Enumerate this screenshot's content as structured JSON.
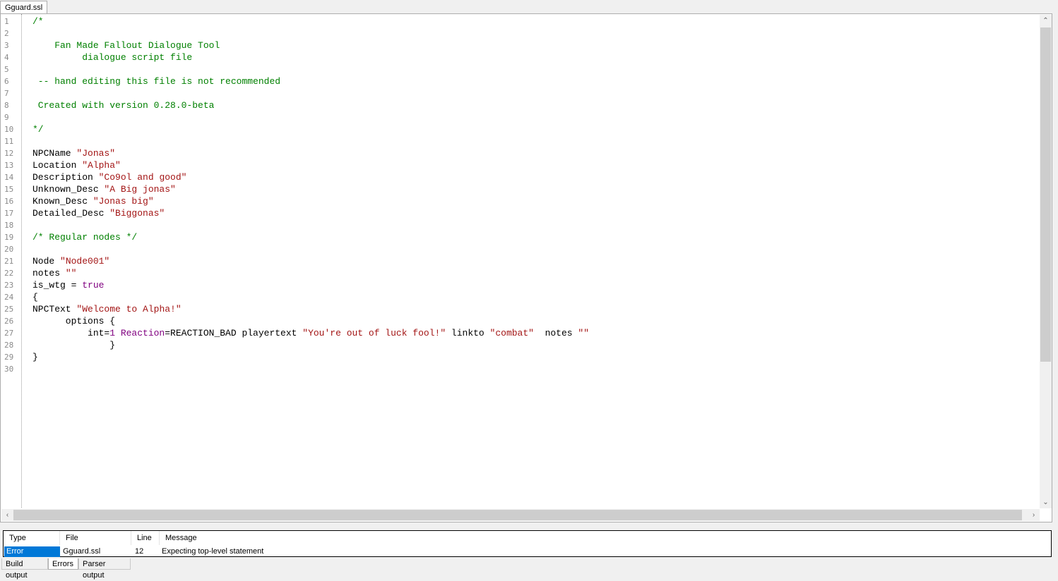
{
  "tabs": {
    "file_tab": "Gguard.ssl"
  },
  "editor": {
    "line_numbers": [
      "1",
      "2",
      "3",
      "4",
      "5",
      "6",
      "7",
      "8",
      "9",
      "10",
      "11",
      "12",
      "13",
      "14",
      "15",
      "16",
      "17",
      "18",
      "19",
      "20",
      "21",
      "22",
      "23",
      "24",
      "25",
      "26",
      "27",
      "28",
      "29",
      "30"
    ],
    "lines": [
      [
        {
          "t": "/*",
          "c": "c"
        }
      ],
      [],
      [
        {
          "t": "    Fan Made Fallout Dialogue Tool",
          "c": "c"
        }
      ],
      [
        {
          "t": "         dialogue script file",
          "c": "c"
        }
      ],
      [],
      [
        {
          "t": " -- hand editing this file is not recommended",
          "c": "c"
        }
      ],
      [],
      [
        {
          "t": " Created with version 0.28.0-beta",
          "c": "c"
        }
      ],
      [],
      [
        {
          "t": "*/",
          "c": "c"
        }
      ],
      [],
      [
        {
          "t": "NPCName ",
          "c": "p"
        },
        {
          "t": "\"Jonas\"",
          "c": "s"
        }
      ],
      [
        {
          "t": "Location ",
          "c": "p"
        },
        {
          "t": "\"Alpha\"",
          "c": "s"
        }
      ],
      [
        {
          "t": "Description ",
          "c": "p"
        },
        {
          "t": "\"Co9ol and good\"",
          "c": "s"
        }
      ],
      [
        {
          "t": "Unknown_Desc ",
          "c": "p"
        },
        {
          "t": "\"A Big jonas\"",
          "c": "s"
        }
      ],
      [
        {
          "t": "Known_Desc ",
          "c": "p"
        },
        {
          "t": "\"Jonas big\"",
          "c": "s"
        }
      ],
      [
        {
          "t": "Detailed_Desc ",
          "c": "p"
        },
        {
          "t": "\"Biggonas\"",
          "c": "s"
        }
      ],
      [],
      [
        {
          "t": "/* Regular nodes */",
          "c": "c"
        }
      ],
      [],
      [
        {
          "t": "Node ",
          "c": "p"
        },
        {
          "t": "\"Node001\"",
          "c": "s"
        }
      ],
      [
        {
          "t": "notes ",
          "c": "p"
        },
        {
          "t": "\"\"",
          "c": "s"
        }
      ],
      [
        {
          "t": "is_wtg = ",
          "c": "p"
        },
        {
          "t": "true",
          "c": "k"
        }
      ],
      [
        {
          "t": "{",
          "c": "p"
        }
      ],
      [
        {
          "t": "NPCText ",
          "c": "p"
        },
        {
          "t": "\"Welcome to Alpha!\"",
          "c": "s"
        }
      ],
      [
        {
          "t": "      options {",
          "c": "p"
        }
      ],
      [
        {
          "t": "          int=",
          "c": "p"
        },
        {
          "t": "1 Reaction",
          "c": "k"
        },
        {
          "t": "=REACTION_BAD playertext ",
          "c": "p"
        },
        {
          "t": "\"You're out of luck fool!\"",
          "c": "s"
        },
        {
          "t": " linkto ",
          "c": "p"
        },
        {
          "t": "\"combat\"",
          "c": "s"
        },
        {
          "t": "  notes ",
          "c": "p"
        },
        {
          "t": "\"\"",
          "c": "s"
        }
      ],
      [
        {
          "t": "              }",
          "c": "p"
        }
      ],
      [
        {
          "t": "}",
          "c": "p"
        }
      ],
      []
    ]
  },
  "errors": {
    "headers": {
      "type": "Type",
      "file": "File",
      "line": "Line",
      "message": "Message"
    },
    "rows": [
      {
        "type": "Error",
        "file": "Gguard.ssl",
        "line": "12",
        "message": "Expecting top-level statement"
      }
    ]
  },
  "bottom_tabs": [
    {
      "label": "Build output"
    },
    {
      "label": "Errors"
    },
    {
      "label": "Parser output"
    }
  ],
  "colors": {
    "comment": "#008000",
    "string": "#a31515",
    "keyword": "#800080",
    "selection": "#0078d7"
  },
  "icons": {
    "scroll_up": "chevron-up-icon",
    "scroll_down": "chevron-down-icon",
    "scroll_left": "chevron-left-icon",
    "scroll_right": "chevron-right-icon"
  }
}
